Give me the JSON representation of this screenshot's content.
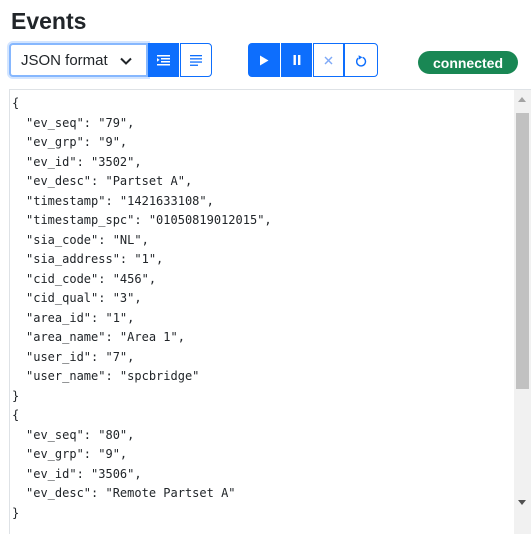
{
  "page": {
    "title": "Events"
  },
  "toolbar": {
    "format_select": {
      "value": "JSON format"
    },
    "icons": {
      "view_compact": "list-compact-icon",
      "view_lines": "list-lines-icon",
      "play": "play-icon",
      "pause": "pause-icon",
      "clear": "close-icon",
      "refresh": "refresh-icon"
    },
    "status_badge": "connected"
  },
  "colors": {
    "accent": "#0d6efd",
    "status": "#198754"
  },
  "events": [
    [
      [
        "ev_seq",
        "79"
      ],
      [
        "ev_grp",
        "9"
      ],
      [
        "ev_id",
        "3502"
      ],
      [
        "ev_desc",
        "Partset A"
      ],
      [
        "timestamp",
        "1421633108"
      ],
      [
        "timestamp_spc",
        "01050819012015"
      ],
      [
        "sia_code",
        "NL"
      ],
      [
        "sia_address",
        "1"
      ],
      [
        "cid_code",
        "456"
      ],
      [
        "cid_qual",
        "3"
      ],
      [
        "area_id",
        "1"
      ],
      [
        "area_name",
        "Area 1"
      ],
      [
        "user_id",
        "7"
      ],
      [
        "user_name",
        "spcbridge"
      ]
    ],
    [
      [
        "ev_seq",
        "80"
      ],
      [
        "ev_grp",
        "9"
      ],
      [
        "ev_id",
        "3506"
      ],
      [
        "ev_desc",
        "Remote Partset A"
      ]
    ]
  ]
}
